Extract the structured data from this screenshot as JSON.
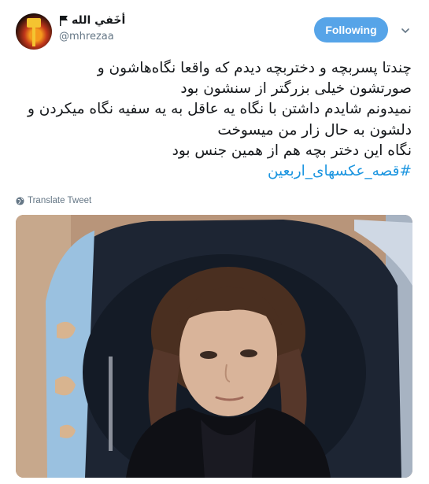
{
  "tweet": {
    "author": {
      "display_name": "أخَفي الله",
      "handle": "@mhrezaa",
      "flag_icon": "black-flag-icon"
    },
    "follow_label": "Following",
    "menu_icon": "chevron-down-icon",
    "text_lines": [
      "چندتا پسربچه و دختربچه دیدم که واقعا نگاه‌هاشون و",
      "صورتشون خیلی بزرگتر از سنشون بود",
      "نمیدونم شایدم داشتن با نگاه یه عاقل به یه سفیه نگاه میکردن و",
      "دلشون به حال زار من میسوخت",
      "نگاه این دختر بچه هم از همین جنس بود"
    ],
    "hashtag": "#قصه_عکسهای_اربعین",
    "translate_label": "Translate Tweet"
  },
  "colors": {
    "follow_button": "#56a4e8",
    "hashtag": "#1b95e0",
    "muted_text": "#657786"
  }
}
